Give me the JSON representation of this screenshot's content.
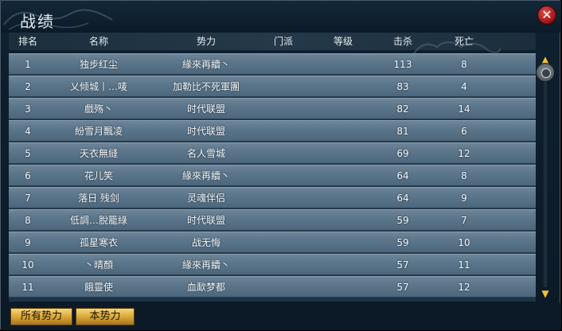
{
  "window": {
    "title": "战绩",
    "close_label": "✕"
  },
  "columns": {
    "rank": "排名",
    "name": "名称",
    "faction": "势力",
    "sect": "门派",
    "level": "等级",
    "kills": "击杀",
    "deaths": "死亡"
  },
  "rows": [
    {
      "rank": "1",
      "name": "独步红尘",
      "faction": "緣來再續丶",
      "sect": "",
      "level": "",
      "kills": "113",
      "deaths": "8"
    },
    {
      "rank": "2",
      "name": "乂倾城丨…唛",
      "faction": "加勒比不死軍團",
      "sect": "",
      "level": "",
      "kills": "83",
      "deaths": "4"
    },
    {
      "rank": "3",
      "name": "戲殇丶",
      "faction": "时代联盟",
      "sect": "",
      "level": "",
      "kills": "82",
      "deaths": "14"
    },
    {
      "rank": "4",
      "name": "紛雪月飄凌",
      "faction": "时代联盟",
      "sect": "",
      "level": "",
      "kills": "81",
      "deaths": "6"
    },
    {
      "rank": "5",
      "name": "天衣無縫",
      "faction": "名人雪城",
      "sect": "",
      "level": "",
      "kills": "69",
      "deaths": "12"
    },
    {
      "rank": "6",
      "name": "花儿笑",
      "faction": "緣來再續丶",
      "sect": "",
      "level": "",
      "kills": "64",
      "deaths": "8"
    },
    {
      "rank": "7",
      "name": "落日 残剑",
      "faction": "灵魂伴侣",
      "sect": "",
      "level": "",
      "kills": "64",
      "deaths": "9"
    },
    {
      "rank": "8",
      "name": "低調…脫籠綠",
      "faction": "时代联盟",
      "sect": "",
      "level": "",
      "kills": "59",
      "deaths": "7"
    },
    {
      "rank": "9",
      "name": "孤星寒衣",
      "faction": "战无悔",
      "sect": "",
      "level": "",
      "kills": "59",
      "deaths": "10"
    },
    {
      "rank": "10",
      "name": "丶晴顏",
      "faction": "緣來再續丶",
      "sect": "",
      "level": "",
      "kills": "57",
      "deaths": "11"
    },
    {
      "rank": "11",
      "name": "餓靈使",
      "faction": "血歃梦都",
      "sect": "",
      "level": "",
      "kills": "57",
      "deaths": "12"
    }
  ],
  "scroll": {
    "up_icon": "▲",
    "down_icon": "▼"
  },
  "footer": {
    "tab_all": "所有势力",
    "tab_own": "本势力"
  },
  "colors": {
    "accent_gold": "#f1c232",
    "close_red": "#c02020",
    "row_blue": "#5d778c"
  }
}
